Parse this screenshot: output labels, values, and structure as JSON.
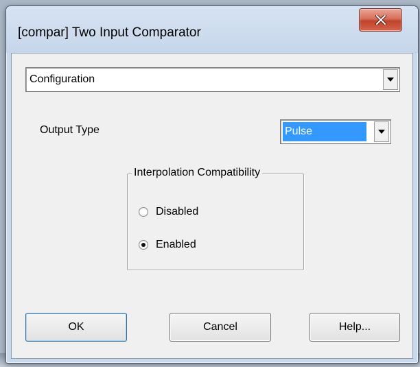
{
  "window": {
    "title": "[compar] Two Input Comparator"
  },
  "section_select": {
    "selected": "Configuration"
  },
  "output_type": {
    "label": "Output Type",
    "selected": "Pulse"
  },
  "interpolation": {
    "group_label": "Interpolation Compatibility",
    "options": [
      {
        "label": "Disabled",
        "checked": false
      },
      {
        "label": "Enabled",
        "checked": true
      }
    ]
  },
  "buttons": {
    "ok": "OK",
    "cancel": "Cancel",
    "help": "Help..."
  },
  "icons": {
    "close": "close-icon",
    "dropdown": "chevron-down-icon"
  },
  "colors": {
    "close_button": "#c7462e",
    "selection_highlight": "#3399ff",
    "dialog_background": "#f0f0f0",
    "frame": "#c9d9ec"
  }
}
